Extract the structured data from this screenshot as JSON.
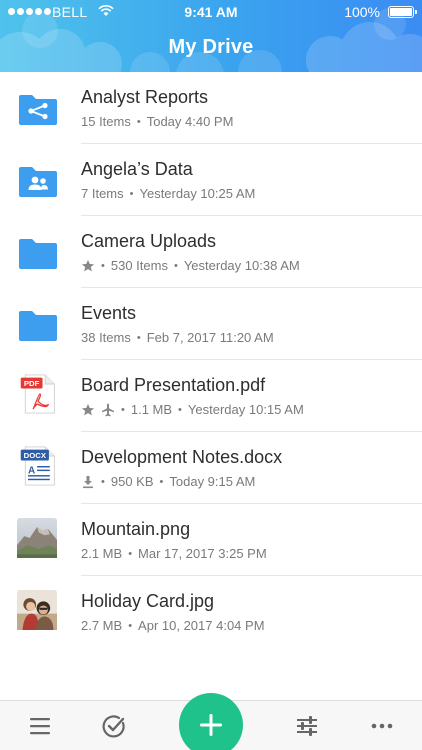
{
  "status_bar": {
    "carrier": "BELL",
    "time": "9:41 AM",
    "battery": "100%"
  },
  "header": {
    "title": "My Drive"
  },
  "colors": {
    "folder": "#3d9ef0",
    "accent": "#1fc28b",
    "meta_text": "#7a7a7a",
    "pdf_red": "#e53935",
    "docx_blue": "#2d5ca8"
  },
  "files": [
    {
      "icon": "shared-folder-icon",
      "name": "Analyst Reports",
      "items": "15 Items",
      "date": "Today 4:40 PM"
    },
    {
      "icon": "people-folder-icon",
      "name": "Angela’s Data",
      "items": "7 Items",
      "date": "Yesterday 10:25 AM"
    },
    {
      "icon": "folder-icon",
      "name": "Camera Uploads",
      "flags": [
        "star-icon"
      ],
      "items": "530 Items",
      "date": "Yesterday 10:38 AM"
    },
    {
      "icon": "folder-icon",
      "name": "Events",
      "items": "38 Items",
      "date": "Feb 7, 2017 11:20 AM"
    },
    {
      "icon": "pdf-icon",
      "icon_label": "PDF",
      "name": "Board Presentation.pdf",
      "flags": [
        "star-icon",
        "airplane-icon"
      ],
      "items": "1.1 MB",
      "date": "Yesterday 10:15 AM"
    },
    {
      "icon": "docx-icon",
      "icon_label": "DOCX",
      "name": "Development Notes.docx",
      "flags": [
        "download-icon"
      ],
      "items": "950 KB",
      "date": "Today 9:15 AM"
    },
    {
      "icon": "mountain-image-thumbnail",
      "name": "Mountain.png",
      "items": "2.1 MB",
      "date": "Mar 17, 2017 3:25 PM"
    },
    {
      "icon": "photo-image-thumbnail",
      "name": "Holiday Card.jpg",
      "items": "2.7 MB",
      "date": "Apr 10, 2017 4:04 PM"
    }
  ],
  "toolbar": {
    "items": [
      "menu-icon",
      "check-circle-icon",
      "add-icon",
      "filter-sliders-icon",
      "more-icon"
    ]
  }
}
